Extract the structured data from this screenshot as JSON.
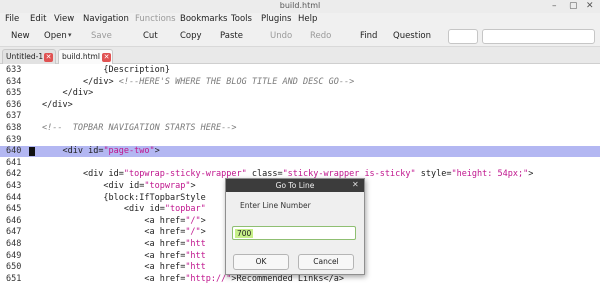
{
  "window": {
    "title": "build.html",
    "minimize": "–",
    "maximize": "▢",
    "close": "✕"
  },
  "menu": [
    "File",
    "Edit",
    "View",
    "Navigation",
    "Functions",
    "Bookmarks",
    "Tools",
    "Plugins",
    "Help"
  ],
  "toolbar": {
    "new": "New",
    "open": "Open",
    "open_caret": "▾",
    "save": "Save",
    "cut": "Cut",
    "copy": "Copy",
    "paste": "Paste",
    "undo": "Undo",
    "redo": "Redo",
    "find": "Find",
    "question": "Question"
  },
  "tabs": [
    {
      "label": "Untitled-1",
      "close": "✕"
    },
    {
      "label": "build.html",
      "close": "✕"
    }
  ],
  "editor": {
    "lines": [
      {
        "n": "633",
        "indent": "            ",
        "parts": [
          {
            "t": "{Description}",
            "c": "tag"
          }
        ]
      },
      {
        "n": "634",
        "indent": "        ",
        "parts": [
          {
            "t": "</div> ",
            "c": "tag"
          },
          {
            "t": "<!--HERE'S WHERE THE BLOG TITLE AND DESC GO-->",
            "c": "cm"
          }
        ]
      },
      {
        "n": "635",
        "indent": "    ",
        "parts": [
          {
            "t": "</div>",
            "c": "tag"
          }
        ]
      },
      {
        "n": "636",
        "indent": "",
        "parts": [
          {
            "t": "</div>",
            "c": "tag"
          }
        ]
      },
      {
        "n": "637",
        "indent": "",
        "parts": []
      },
      {
        "n": "638",
        "indent": "",
        "parts": [
          {
            "t": "<!--  TOPBAR NAVIGATION STARTS HERE-->",
            "c": "cm"
          }
        ]
      },
      {
        "n": "639",
        "indent": "",
        "parts": []
      },
      {
        "n": "640",
        "indent": "    ",
        "parts": [
          {
            "t": "<div ",
            "c": "tag"
          },
          {
            "t": "id=",
            "c": "attr"
          },
          {
            "t": "\"page-two\"",
            "c": "str"
          },
          {
            "t": ">",
            "c": "tag"
          }
        ]
      },
      {
        "n": "641",
        "indent": "",
        "parts": []
      },
      {
        "n": "642",
        "indent": "        ",
        "parts": [
          {
            "t": "<div ",
            "c": "tag"
          },
          {
            "t": "id=",
            "c": "attr"
          },
          {
            "t": "\"topwrap-sticky-wrapper\"",
            "c": "str"
          },
          {
            "t": " class=",
            "c": "attr"
          },
          {
            "t": "\"sticky-wrapper is-sticky\"",
            "c": "str"
          },
          {
            "t": " style=",
            "c": "attr"
          },
          {
            "t": "\"height: 54px;\"",
            "c": "str"
          },
          {
            "t": ">",
            "c": "tag"
          }
        ]
      },
      {
        "n": "643",
        "indent": "            ",
        "parts": [
          {
            "t": "<div ",
            "c": "tag"
          },
          {
            "t": "id=",
            "c": "attr"
          },
          {
            "t": "\"topwrap\"",
            "c": "str"
          },
          {
            "t": ">",
            "c": "tag"
          }
        ]
      },
      {
        "n": "644",
        "indent": "            ",
        "parts": [
          {
            "t": "{block:IfTopbarStyle",
            "c": "tag"
          }
        ]
      },
      {
        "n": "645",
        "indent": "                ",
        "parts": [
          {
            "t": "<div ",
            "c": "tag"
          },
          {
            "t": "id=",
            "c": "attr"
          },
          {
            "t": "\"topbar\"",
            "c": "str"
          }
        ]
      },
      {
        "n": "646",
        "indent": "                    ",
        "parts": [
          {
            "t": "<a ",
            "c": "tag"
          },
          {
            "t": "href=",
            "c": "attr"
          },
          {
            "t": "\"/\"",
            "c": "str"
          },
          {
            "t": ">",
            "c": "tag"
          }
        ]
      },
      {
        "n": "647",
        "indent": "                    ",
        "parts": [
          {
            "t": "<a ",
            "c": "tag"
          },
          {
            "t": "href=",
            "c": "attr"
          },
          {
            "t": "\"/\"",
            "c": "str"
          },
          {
            "t": ">",
            "c": "tag"
          }
        ]
      },
      {
        "n": "648",
        "indent": "                    ",
        "parts": [
          {
            "t": "<a ",
            "c": "tag"
          },
          {
            "t": "href=",
            "c": "attr"
          },
          {
            "t": "\"htt",
            "c": "str"
          }
        ]
      },
      {
        "n": "649",
        "indent": "                    ",
        "parts": [
          {
            "t": "<a ",
            "c": "tag"
          },
          {
            "t": "href=",
            "c": "attr"
          },
          {
            "t": "\"htt",
            "c": "str"
          }
        ]
      },
      {
        "n": "650",
        "indent": "                    ",
        "parts": [
          {
            "t": "<a ",
            "c": "tag"
          },
          {
            "t": "href=",
            "c": "attr"
          },
          {
            "t": "\"htt",
            "c": "str"
          }
        ]
      },
      {
        "n": "651",
        "indent": "                    ",
        "parts": [
          {
            "t": "<a ",
            "c": "tag"
          },
          {
            "t": "href=",
            "c": "attr"
          },
          {
            "t": "\"http://\"",
            "c": "str"
          },
          {
            "t": ">Recommended Links</a>",
            "c": "tag"
          }
        ]
      }
    ],
    "highlighted_line": "640",
    "bookmark_line": "640"
  },
  "dialog": {
    "title": "Go To Line",
    "close": "✕",
    "prompt": "Enter Line Number",
    "value": "700",
    "ok": "OK",
    "cancel": "Cancel"
  }
}
